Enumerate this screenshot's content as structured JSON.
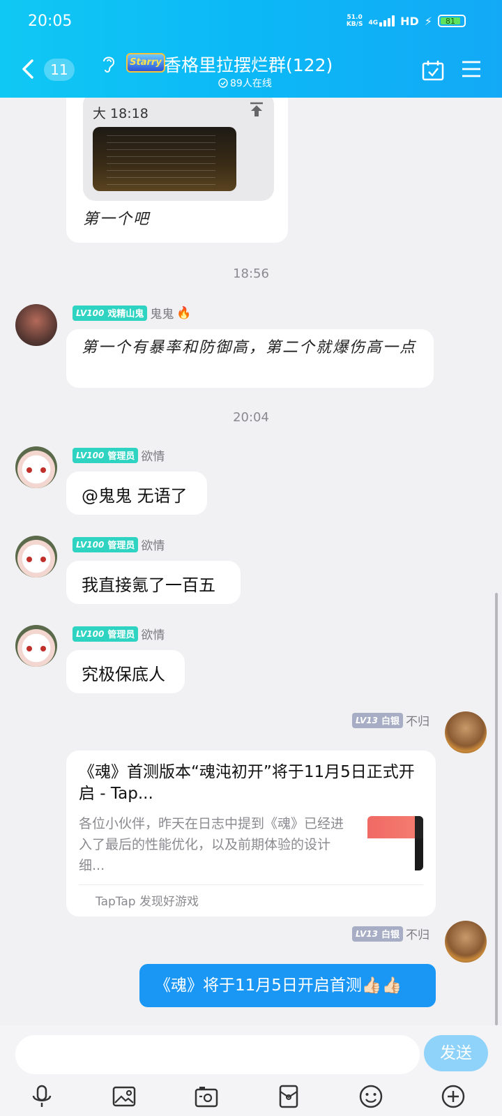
{
  "status_bar": {
    "time": "20:05",
    "net_speed_top": "51.0",
    "net_speed_bottom": "KB/S",
    "network": "4G",
    "hd": "HD",
    "battery": "81"
  },
  "header": {
    "unread_count": "11",
    "group_logo_text": "Starry",
    "group_name": "香格里拉摆烂群(122)",
    "online_text": "89人在线"
  },
  "messages": {
    "quoted": {
      "sender_time": "大 18:18",
      "text": "第一个吧"
    },
    "ts1": "18:56",
    "m1": {
      "level": "LV100",
      "title": "戏精山鬼",
      "nick": "鬼鬼",
      "text": "第一个有暴率和防御高，第二个就爆伤高一点"
    },
    "ts2": "20:04",
    "m2": {
      "level": "LV100",
      "title": "管理员",
      "nick": "欲情",
      "text": "@鬼鬼 无语了"
    },
    "m3": {
      "level": "LV100",
      "title": "管理员",
      "nick": "欲情",
      "text": "我直接氪了一百五"
    },
    "m4": {
      "level": "LV100",
      "title": "管理员",
      "nick": "欲情",
      "text": "究极保底人"
    },
    "m5": {
      "level": "LV13",
      "title": "白银",
      "nick": "不归",
      "link_title": "《魂》首测版本“魂沌初开”将于11月5日正式开启 - Tap...",
      "link_desc": "各位小伙伴，昨天在日志中提到《魂》已经进入了最后的性能优化，以及前期体验的设计细...",
      "link_source": "TapTap 发现好游戏"
    },
    "m6": {
      "level": "LV13",
      "title": "白银",
      "nick": "不归",
      "text": "《魂》将于11月5日开启首测👍🏻👍🏻"
    }
  },
  "input": {
    "placeholder": "",
    "send_label": "发送"
  },
  "colors": {
    "header_accent": "#0cb8f6",
    "sent_bubble": "#1a97f5",
    "admin_badge": "#2fd3c1",
    "silver_badge": "#a6adc4"
  }
}
